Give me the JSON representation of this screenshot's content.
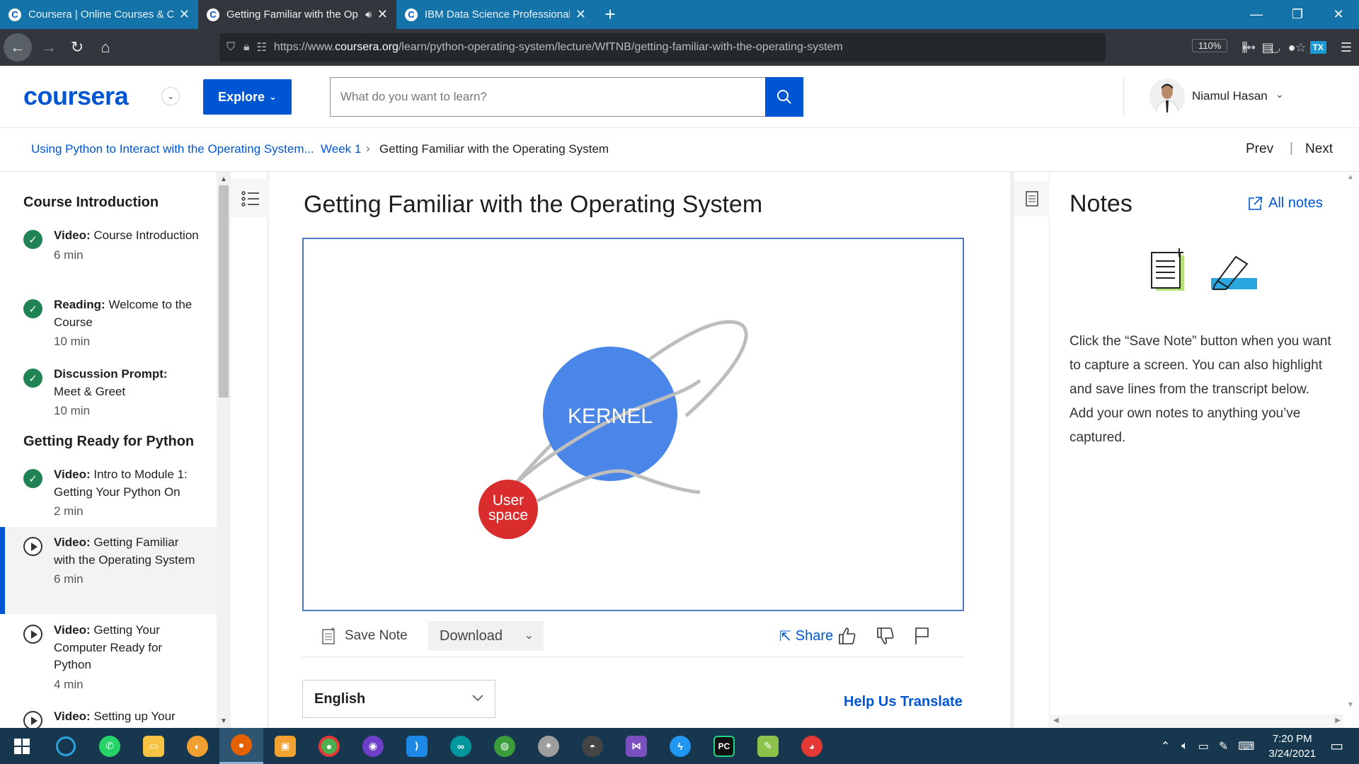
{
  "browser": {
    "tabs": [
      {
        "title": "Coursera | Online Courses & Cr",
        "active": false
      },
      {
        "title": "Getting Familiar with the Op",
        "active": true
      },
      {
        "title": "IBM Data Science Professional",
        "active": false
      }
    ],
    "url_prefix": "https://www.",
    "url_domain": "coursera.org",
    "url_path": "/learn/python-operating-system/lecture/WfTNB/getting-familiar-with-the-operating-system",
    "zoom": "110%"
  },
  "header": {
    "logo": "coursera",
    "explore_label": "Explore",
    "search_placeholder": "What do you want to learn?",
    "user_name": "Niamul Hasan"
  },
  "breadcrumb": {
    "course": "Using Python to Interact with the Operating System...",
    "week": "Week 1",
    "current": "Getting Familiar with the Operating System",
    "prev": "Prev",
    "next": "Next"
  },
  "sidebar": {
    "sections": [
      {
        "title": "Course Introduction"
      },
      {
        "title": "Getting Ready for Python"
      }
    ],
    "items": [
      {
        "type": "Video:",
        "title": "Course Introduction",
        "duration": "6 min",
        "status": "done"
      },
      {
        "type": "Reading:",
        "title": "Welcome to the Course",
        "duration": "10 min",
        "status": "done"
      },
      {
        "type": "Discussion Prompt:",
        "title": "Meet & Greet",
        "duration": "10 min",
        "status": "done"
      },
      {
        "type": "Video:",
        "title": "Intro to Module 1: Getting Your Python On",
        "duration": "2 min",
        "status": "done"
      },
      {
        "type": "Video:",
        "title": "Getting Familiar with the Operating System",
        "duration": "6 min",
        "status": "current"
      },
      {
        "type": "Video:",
        "title": "Getting Your Computer Ready for Python",
        "duration": "4 min",
        "status": "todo"
      },
      {
        "type": "Video:",
        "title": "Setting up Your",
        "duration": "",
        "status": "todo"
      }
    ]
  },
  "main": {
    "title": "Getting Familiar with the Operating System",
    "video": {
      "kernel_label": "KERNEL",
      "user_space_label_1": "User",
      "user_space_label_2": "space"
    },
    "save_note": "Save Note",
    "download": "Download",
    "share": "Share",
    "language": "English",
    "help_translate": "Help Us Translate"
  },
  "notes": {
    "title": "Notes",
    "all_notes": "All notes",
    "instructions": "Click the “Save Note” button when you want to capture a screen. You can also highlight and save lines from the transcript below. Add your own notes to anything you’ve captured."
  },
  "taskbar": {
    "time": "7:20 PM",
    "date": "3/24/2021"
  },
  "colors": {
    "brand": "#0056d2",
    "complete": "#1f8354",
    "kernel": "#4a86e8",
    "user_space": "#d92d2d",
    "tabbar": "#1473a8"
  }
}
